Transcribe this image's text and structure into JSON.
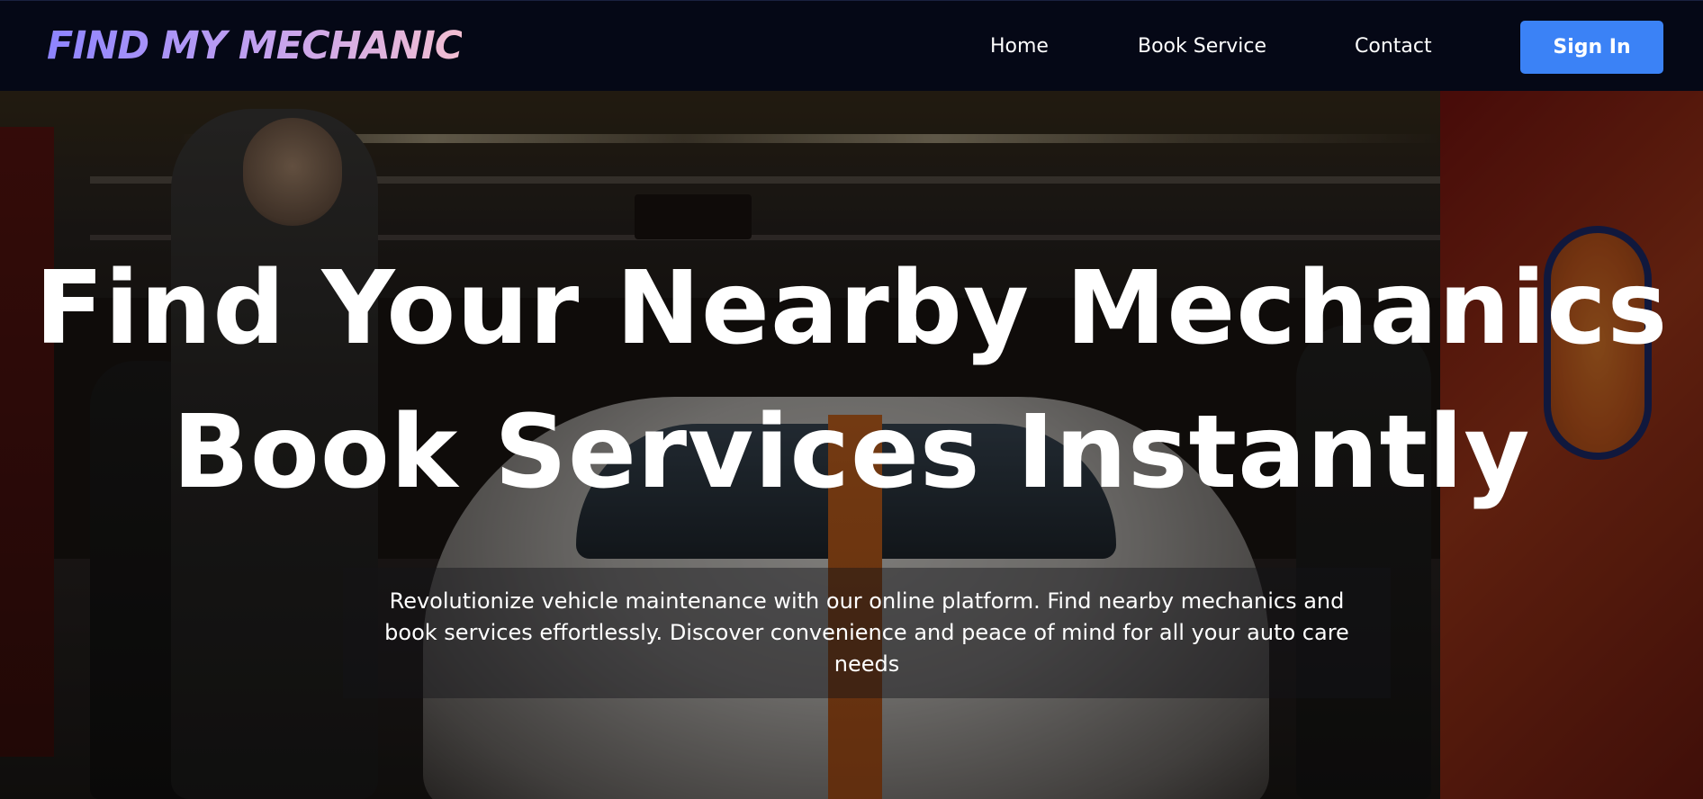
{
  "navbar": {
    "logo": "FIND MY MECHANIC",
    "links": {
      "home": "Home",
      "book_service": "Book Service",
      "contact": "Contact"
    },
    "sign_in_label": "Sign In"
  },
  "hero": {
    "title_line_1": "Find Your Nearby Mechanics",
    "title_line_2": "Book Services Instantly",
    "description": "Revolutionize vehicle maintenance with our online platform. Find nearby mechanics and book services effortlessly. Discover convenience and peace of mind for all your auto care needs"
  },
  "colors": {
    "navbar_bg": "#050816",
    "sign_in_button": "#3b82f6",
    "logo_gradient_start": "#8d84ff",
    "logo_gradient_end": "#f3bfd2"
  }
}
